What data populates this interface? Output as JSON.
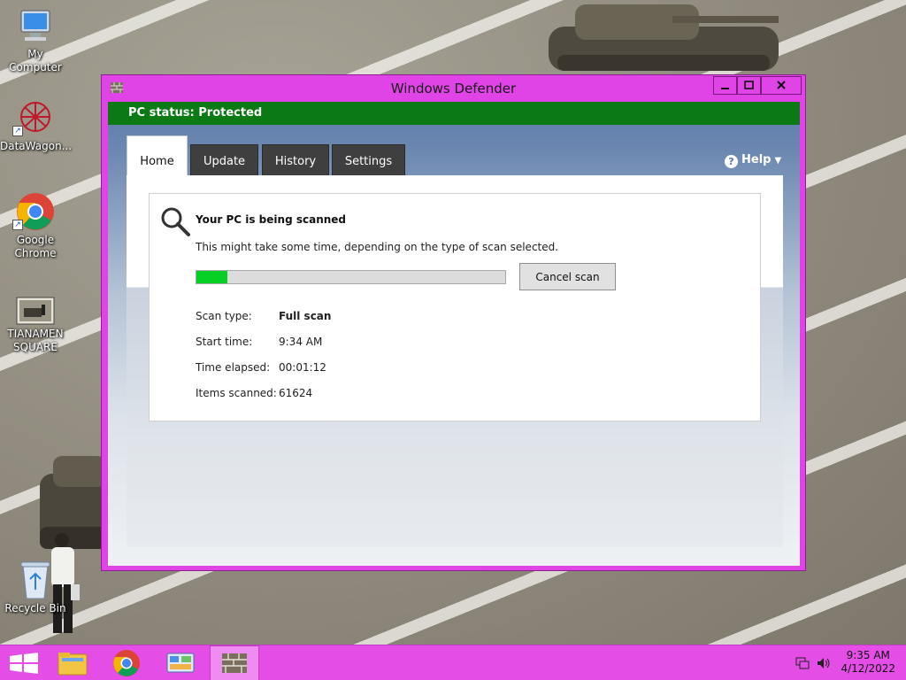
{
  "desktop": {
    "icons": [
      {
        "label": "My Computer",
        "icon": "computer-icon"
      },
      {
        "label": "DataWagon...",
        "icon": "datawagon-icon"
      },
      {
        "label": "Google Chrome",
        "icon": "chrome-icon"
      },
      {
        "label": "TIANAMEN SQUARE",
        "icon": "image-file-icon"
      },
      {
        "label": "Recycle Bin",
        "icon": "recycle-bin-icon"
      }
    ]
  },
  "window": {
    "title": "Windows Defender",
    "status": "PC status: Protected",
    "colors": {
      "frame": "#e044e6",
      "status_bar": "#0b7a14",
      "progress": "#06d026"
    },
    "tabs": [
      {
        "label": "Home",
        "active": true
      },
      {
        "label": "Update",
        "active": false
      },
      {
        "label": "History",
        "active": false
      },
      {
        "label": "Settings",
        "active": false
      }
    ],
    "help_label": "Help",
    "scan": {
      "title": "Your PC is being scanned",
      "description": "This might take some time, depending on the type of scan selected.",
      "progress_percent": 10,
      "cancel_label": "Cancel scan",
      "details": [
        {
          "label": "Scan type:",
          "value": "Full scan"
        },
        {
          "label": "Start time:",
          "value": "9:34 AM"
        },
        {
          "label": "Time elapsed:",
          "value": "00:01:12"
        },
        {
          "label": "Items scanned:",
          "value": "61624"
        }
      ]
    }
  },
  "taskbar": {
    "items": [
      "start-button",
      "file-explorer-icon",
      "chrome-icon",
      "control-panel-icon",
      "windows-defender-icon"
    ],
    "time": "9:35 AM",
    "date": "4/12/2022",
    "color": "#e44ee6"
  }
}
